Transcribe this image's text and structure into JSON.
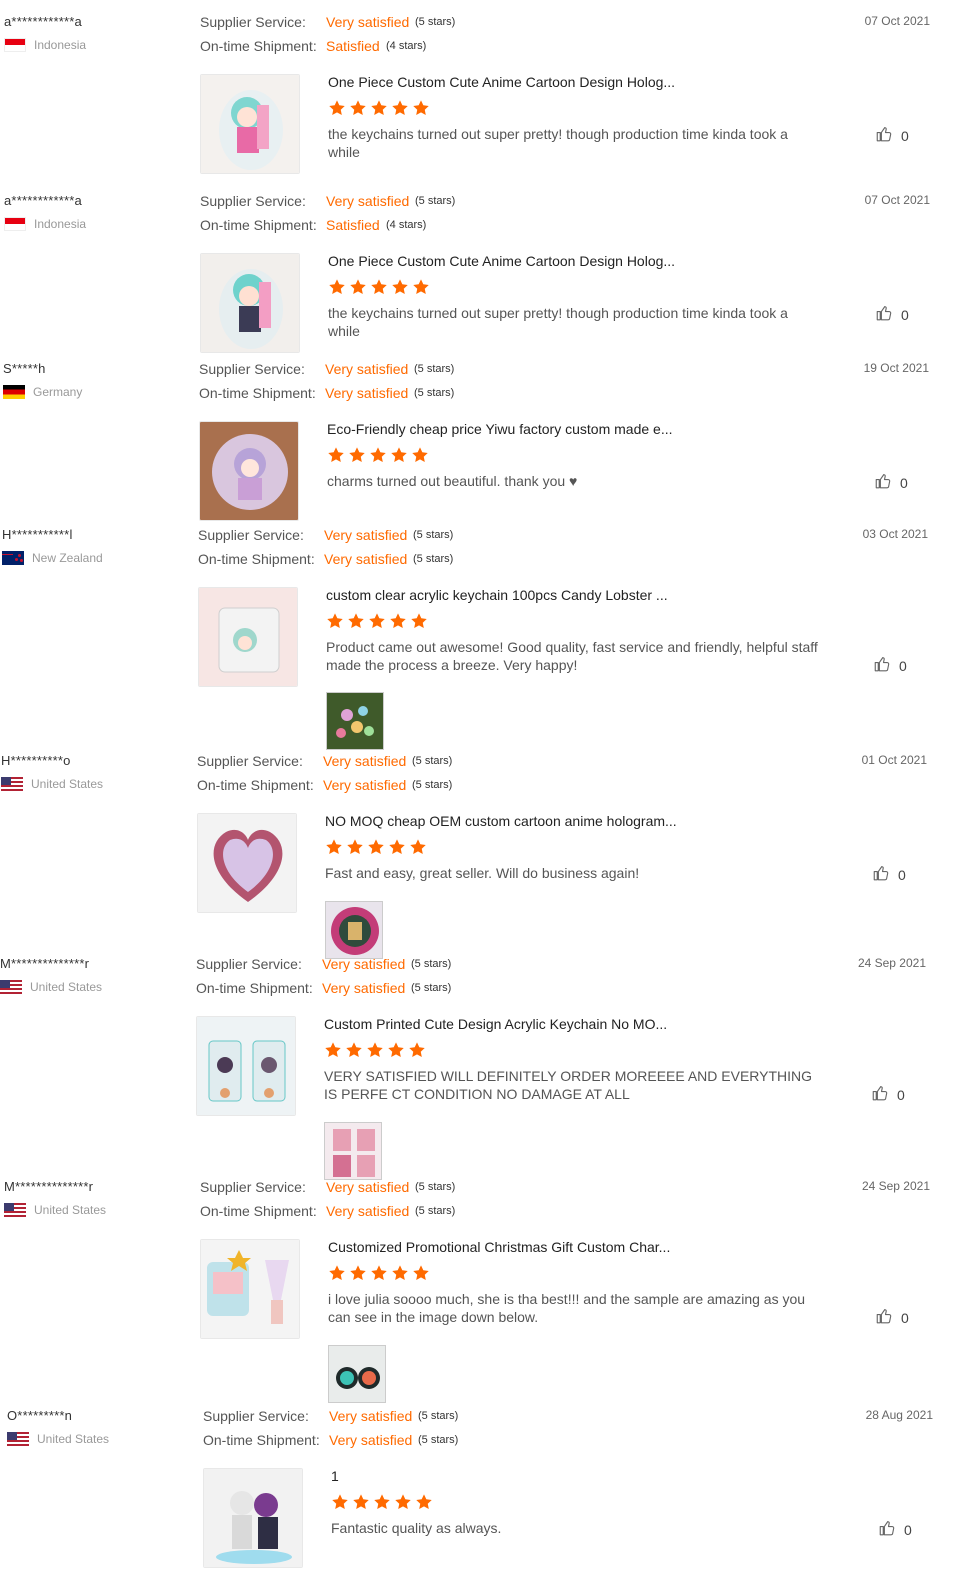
{
  "labels": {
    "supplier_service": "Supplier Service:",
    "ontime_shipment": "On-time Shipment:"
  },
  "icons": {
    "star": "star-icon",
    "like": "thumbs-up-icon",
    "heart": "heart-icon"
  },
  "colors": {
    "accent": "#ff6a00",
    "text": "#333333",
    "muted": "#999999"
  },
  "reviews": [
    {
      "buyer": "a************a",
      "country": "Indonesia",
      "date": "07 Oct 2021",
      "supplier_rating": "Very satisfied",
      "supplier_stars": "(5 stars)",
      "shipment_rating": "Satisfied",
      "shipment_stars": "(4 stars)",
      "product_title": "One Piece Custom Cute Anime Cartoon Design Holog...",
      "stars": 5,
      "comment": "the keychains turned out super pretty! though production time kinda took a while",
      "likes": "0"
    },
    {
      "buyer": "a************a",
      "country": "Indonesia",
      "date": "07 Oct 2021",
      "supplier_rating": "Very satisfied",
      "supplier_stars": "(5 stars)",
      "shipment_rating": "Satisfied",
      "shipment_stars": "(4 stars)",
      "product_title": "One Piece Custom Cute Anime Cartoon Design Holog...",
      "stars": 5,
      "comment": "the keychains turned out super pretty! though production time kinda took a while",
      "likes": "0"
    },
    {
      "buyer": "S*****h",
      "country": "Germany",
      "date": "19 Oct 2021",
      "supplier_rating": "Very satisfied",
      "supplier_stars": "(5 stars)",
      "shipment_rating": "Very satisfied",
      "shipment_stars": "(5 stars)",
      "product_title": "Eco-Friendly cheap price Yiwu factory custom made e...",
      "stars": 5,
      "comment": "charms turned out beautiful. thank you ♥",
      "likes": "0"
    },
    {
      "buyer": "H***********l",
      "country": "New Zealand",
      "date": "03 Oct 2021",
      "supplier_rating": "Very satisfied",
      "supplier_stars": "(5 stars)",
      "shipment_rating": "Very satisfied",
      "shipment_stars": "(5 stars)",
      "product_title": "custom clear acrylic keychain 100pcs Candy Lobster ...",
      "stars": 5,
      "comment": "Product came out awesome! Good quality, fast service and friendly, helpful staff made the process a breeze. Very happy!",
      "likes": "0"
    },
    {
      "buyer": "H**********o",
      "country": "United States",
      "date": "01 Oct 2021",
      "supplier_rating": "Very satisfied",
      "supplier_stars": "(5 stars)",
      "shipment_rating": "Very satisfied",
      "shipment_stars": "(5 stars)",
      "product_title": "NO MOQ cheap OEM custom cartoon anime hologram...",
      "stars": 5,
      "comment": "Fast and easy, great seller. Will do business again!",
      "likes": "0"
    },
    {
      "buyer": "M**************r",
      "country": "United States",
      "date": "24 Sep 2021",
      "supplier_rating": "Very satisfied",
      "supplier_stars": "(5 stars)",
      "shipment_rating": "Very satisfied",
      "shipment_stars": "(5 stars)",
      "product_title": "Custom Printed Cute Design Acrylic Keychain No MO...",
      "stars": 5,
      "comment": "VERY SATISFIED WILL DEFINITELY ORDER MOREEEE AND EVERYTHING IS PERFE CT CONDITION NO DAMAGE AT ALL",
      "likes": "0"
    },
    {
      "buyer": "M**************r",
      "country": "United States",
      "date": "24 Sep 2021",
      "supplier_rating": "Very satisfied",
      "supplier_stars": "(5 stars)",
      "shipment_rating": "Very satisfied",
      "shipment_stars": "(5 stars)",
      "product_title": "Customized Promotional Christmas Gift Custom Char...",
      "stars": 5,
      "comment": "i love julia soooo much, she is tha best!!! and the sample are amazing as you can see in the image down below.",
      "likes": "0"
    },
    {
      "buyer": "O*********n",
      "country": "United States",
      "date": "28 Aug 2021",
      "supplier_rating": "Very satisfied",
      "supplier_stars": "(5 stars)",
      "shipment_rating": "Very satisfied",
      "shipment_stars": "(5 stars)",
      "product_title": "1",
      "stars": 5,
      "comment": "Fantastic quality as always.",
      "likes": "0"
    }
  ]
}
